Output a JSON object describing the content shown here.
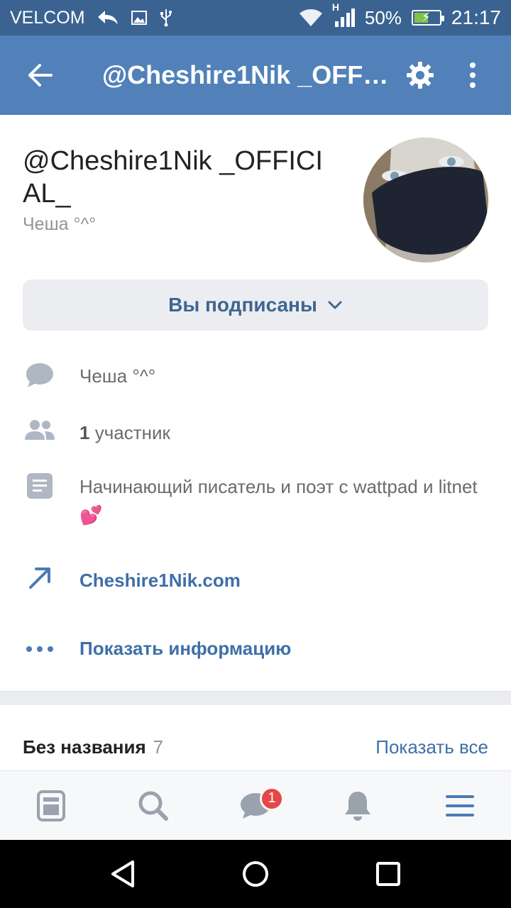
{
  "status_bar": {
    "carrier": "VELCOM",
    "network": "H",
    "battery": "50%",
    "time": "21:17"
  },
  "header": {
    "title": "@Cheshire1Nik _OFFICIAL_",
    "icons": [
      "back-arrow-icon",
      "gear-icon",
      "more-vertical-icon"
    ]
  },
  "profile": {
    "name": "@Cheshire1Nik _OFFICIAL_",
    "status": "Чеша °^°",
    "subscribe_label": "Вы подписаны"
  },
  "info": {
    "status_text": "Чеша °^°",
    "members_count": "1",
    "members_label": " участник",
    "description": "Начинающий писатель и поэт с wattpad и litnet 💕",
    "link": "Cheshire1Nik.com",
    "show_info": "Показать информацию"
  },
  "section": {
    "title": "Без названия",
    "count": "7",
    "show_all": "Показать все"
  },
  "tabbar": {
    "messages_badge": "1"
  },
  "colors": {
    "status_bar": "#3a6391",
    "header": "#5181b8",
    "accent": "#3f6fa8",
    "badge": "#e64646"
  }
}
